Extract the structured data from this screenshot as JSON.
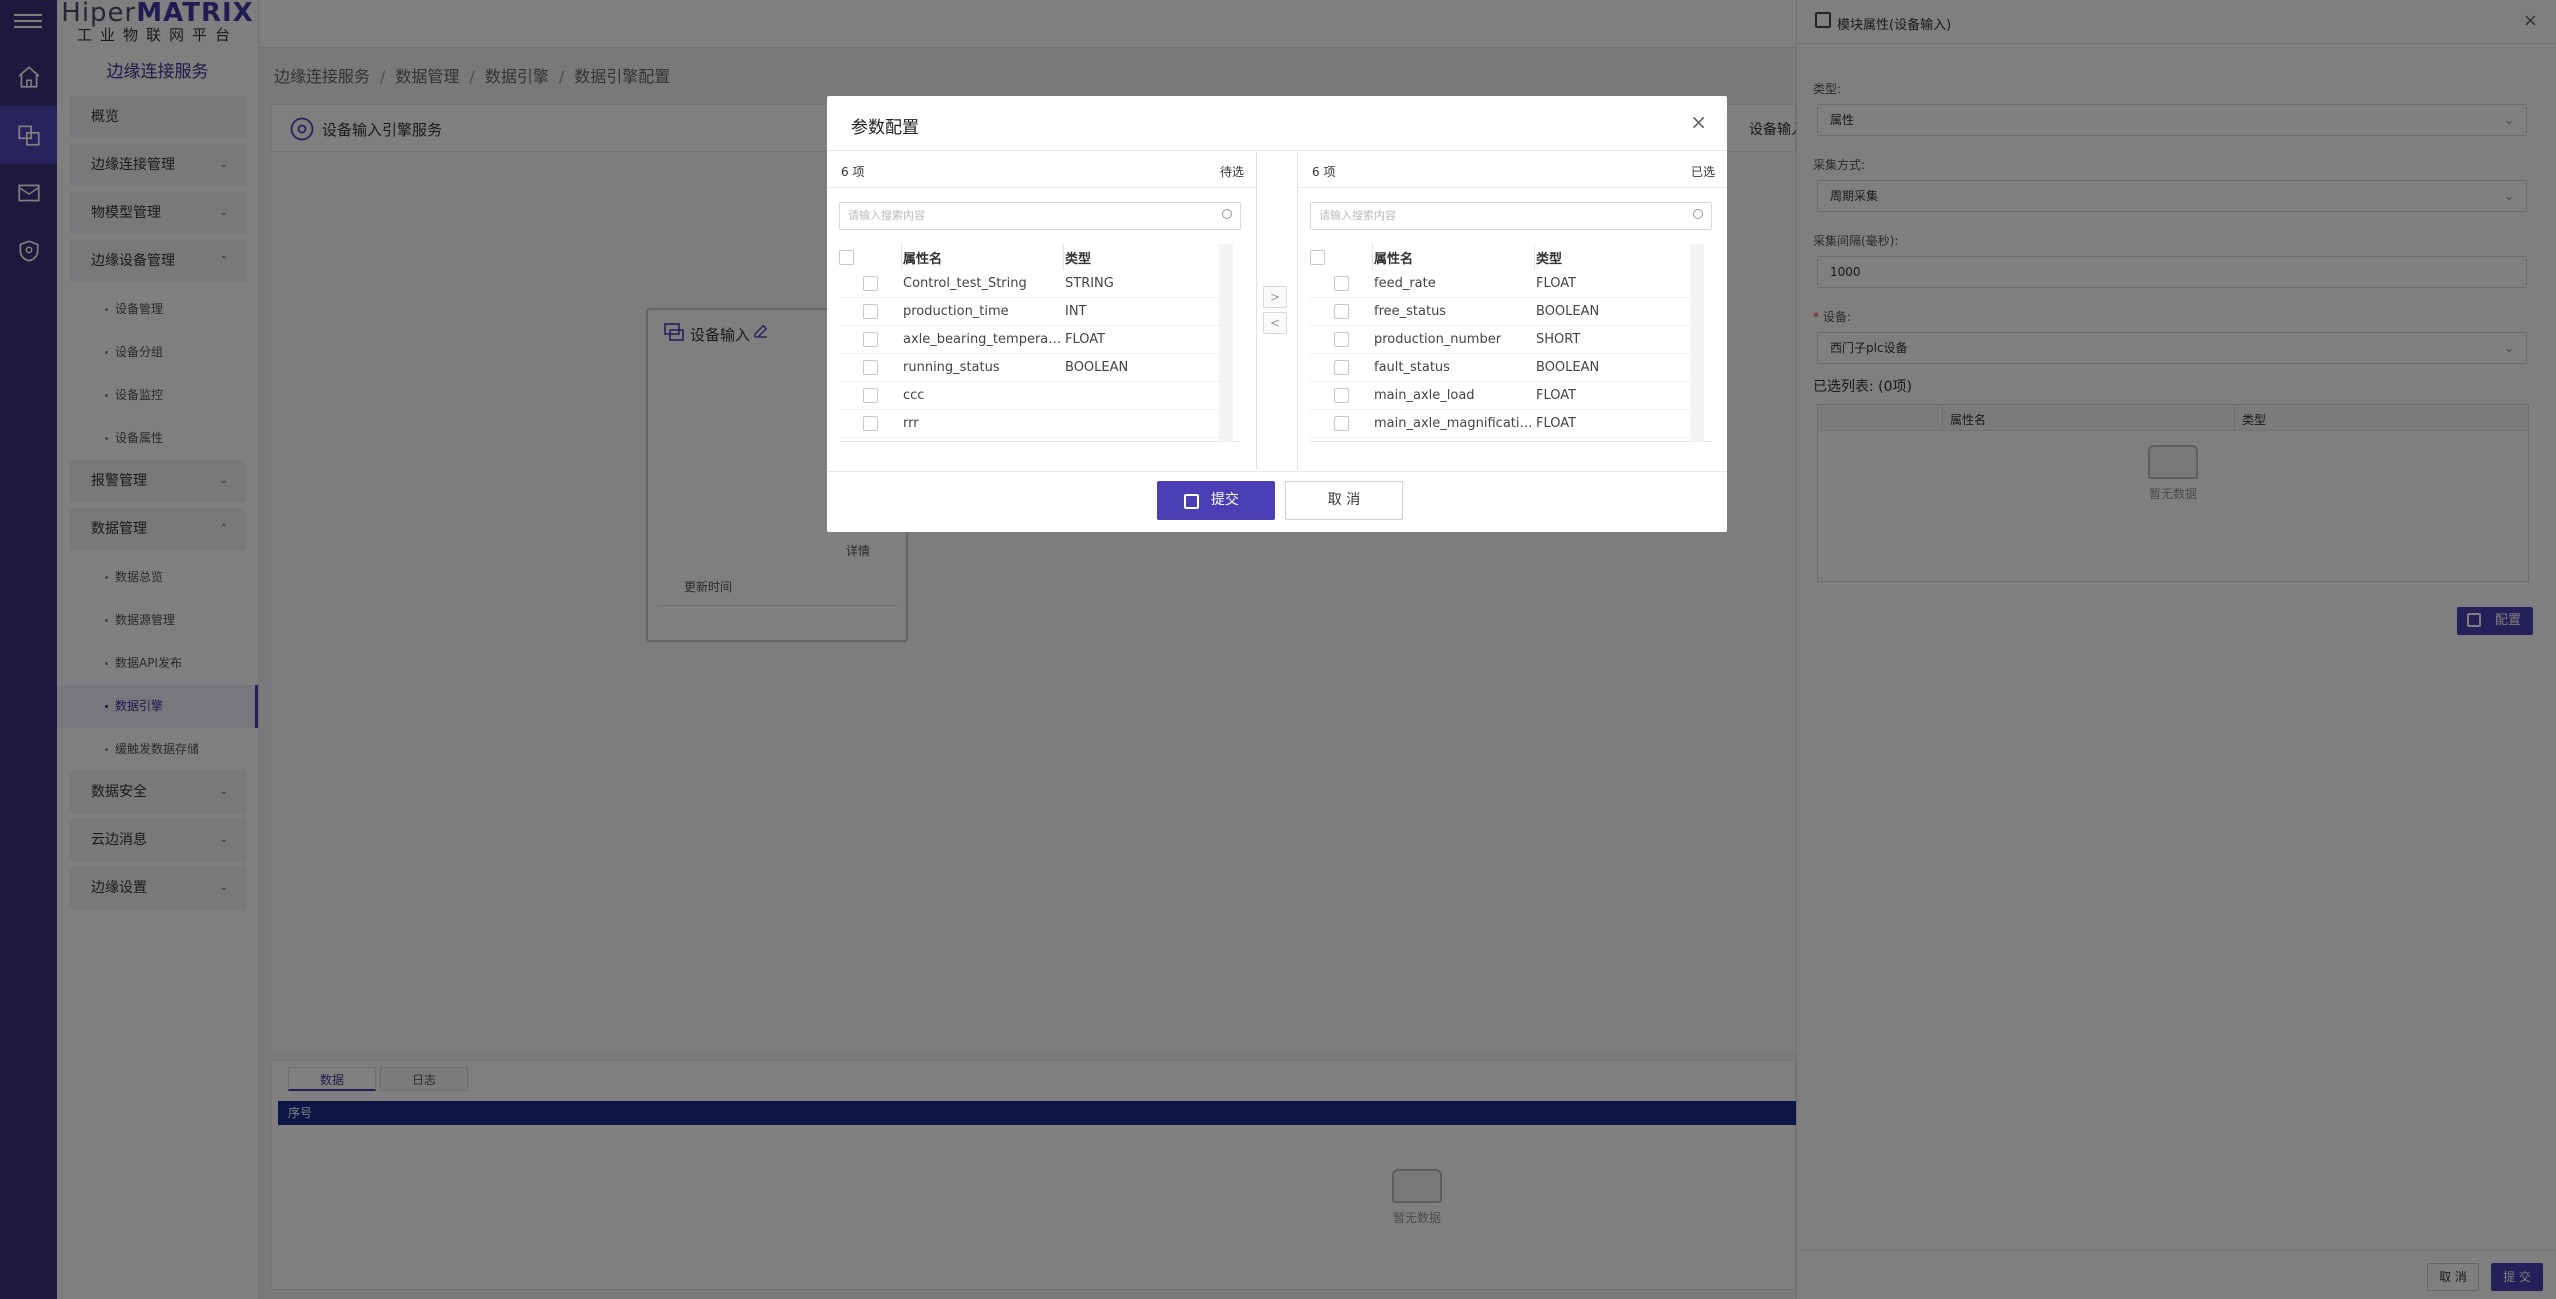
{
  "logo": {
    "brand_prefix": "Hiper",
    "brand_suffix": "MATRIX",
    "subtitle": "工业物联网平台"
  },
  "menu": {
    "service_title": "边缘连接服务",
    "items": [
      {
        "label": "概览"
      },
      {
        "label": "边缘连接管理"
      },
      {
        "label": "物模型管理"
      },
      {
        "label": "边缘设备管理"
      },
      {
        "label": "设备管理"
      },
      {
        "label": "设备分组"
      },
      {
        "label": "设备监控"
      },
      {
        "label": "设备属性"
      },
      {
        "label": "报警管理"
      },
      {
        "label": "数据管理"
      },
      {
        "label": "数据总览"
      },
      {
        "label": "数据源管理"
      },
      {
        "label": "数据API发布"
      },
      {
        "label": "数据引擎"
      },
      {
        "label": "缓触发数据存储"
      },
      {
        "label": "数据安全"
      },
      {
        "label": "云边消息"
      },
      {
        "label": "边缘设置"
      }
    ]
  },
  "breadcrumb": [
    "边缘连接服务",
    "数据管理",
    "数据引擎",
    "数据引擎配置"
  ],
  "panel": {
    "title": "设备输入引擎服务",
    "right_label": "设备输入"
  },
  "node": {
    "title": "设备输入",
    "detail": "详情",
    "update_time": "更新时间"
  },
  "bottom": {
    "tabs": [
      "数据",
      "日志"
    ],
    "header_col": "序号",
    "empty": "暂无数据"
  },
  "drawer": {
    "title": "模块属性(设备输入)",
    "type_label": "类型:",
    "type_value": "属性",
    "collect_label": "采集方式:",
    "collect_value": "周期采集",
    "interval_label": "采集间隔(毫秒):",
    "interval_value": "1000",
    "device_label": "设备:",
    "device_value": "西门子plc设备",
    "selected_title": "已选列表: (0项)",
    "col_name": "属性名",
    "col_type": "类型",
    "empty": "暂无数据",
    "config_button": "配置",
    "cancel_button": "取 消",
    "submit_button": "提 交"
  },
  "modal": {
    "title": "参数配置",
    "left": {
      "count": "6 项",
      "label": "待选",
      "search_placeholder": "请输入搜索内容",
      "col_name": "属性名",
      "col_type": "类型",
      "rows": [
        {
          "name": "Control_test_String",
          "type": "STRING"
        },
        {
          "name": "production_time",
          "type": "INT"
        },
        {
          "name": "axle_bearing_temperat...",
          "type": "FLOAT"
        },
        {
          "name": "running_status",
          "type": "BOOLEAN"
        },
        {
          "name": "ccc",
          "type": ""
        },
        {
          "name": "rrr",
          "type": ""
        }
      ]
    },
    "right": {
      "count": "6 项",
      "label": "已选",
      "search_placeholder": "请输入搜索内容",
      "col_name": "属性名",
      "col_type": "类型",
      "rows": [
        {
          "name": "feed_rate",
          "type": "FLOAT"
        },
        {
          "name": "free_status",
          "type": "BOOLEAN"
        },
        {
          "name": "production_number",
          "type": "SHORT"
        },
        {
          "name": "fault_status",
          "type": "BOOLEAN"
        },
        {
          "name": "main_axle_load",
          "type": "FLOAT"
        },
        {
          "name": "main_axle_magnification",
          "type": "FLOAT"
        }
      ]
    },
    "move_right": ">",
    "move_left": "<",
    "submit": "提交",
    "cancel": "取 消"
  },
  "colors": {
    "primary": "#4a3fb5",
    "rail": "#3a3178",
    "table_header": "#1c2c8c"
  }
}
